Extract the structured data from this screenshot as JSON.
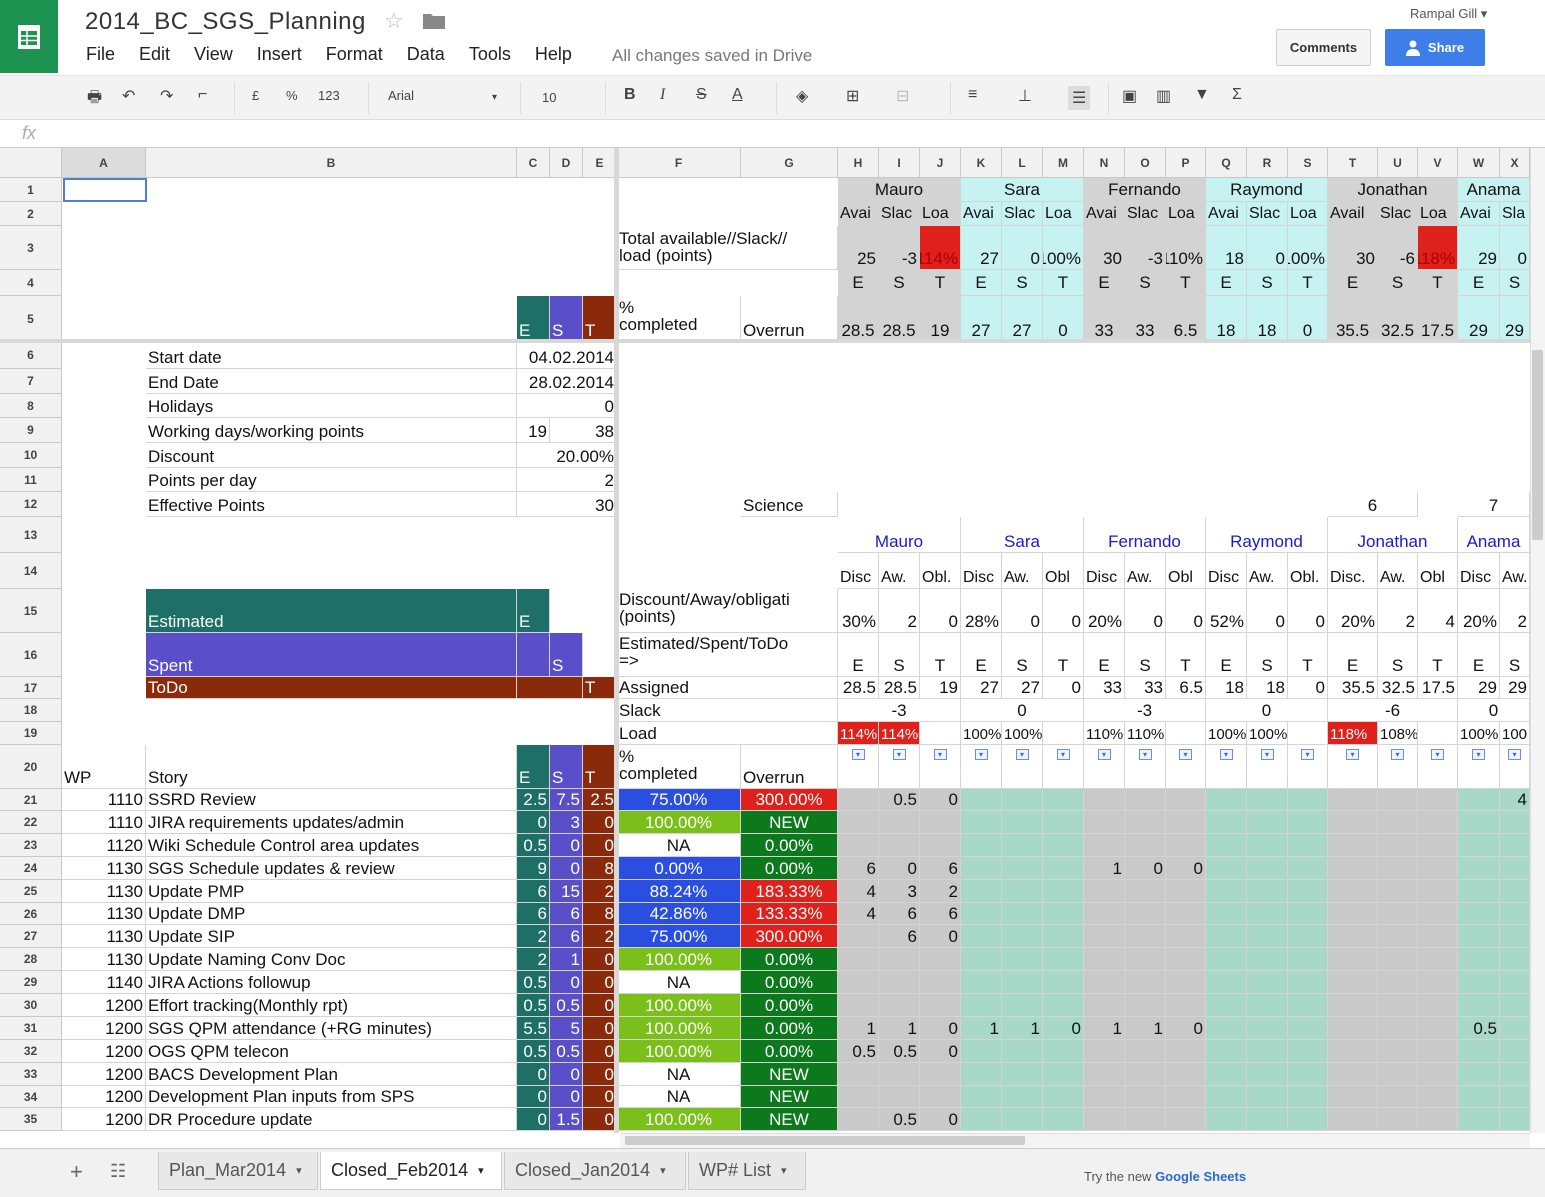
{
  "doc": {
    "title": "2014_BC_SGS_Planning",
    "save_status": "All changes saved in Drive",
    "user": "Rampal Gill",
    "comments": "Comments",
    "share": "Share"
  },
  "menu": [
    "File",
    "Edit",
    "View",
    "Insert",
    "Format",
    "Data",
    "Tools",
    "Help"
  ],
  "toolbar": {
    "font": "Arial",
    "size": "10",
    "currency": "£",
    "percent": "%",
    "format": "123"
  },
  "formula": {
    "fx": "fx"
  },
  "columns": [
    "A",
    "B",
    "C",
    "D",
    "E",
    "F",
    "G",
    "H",
    "I",
    "J",
    "K",
    "L",
    "M",
    "N",
    "O",
    "P",
    "Q",
    "R",
    "S",
    "T",
    "U",
    "V",
    "W",
    "X"
  ],
  "rows": [
    "1",
    "2",
    "3",
    "4",
    "5",
    "6",
    "7",
    "8",
    "9",
    "10",
    "11",
    "12",
    "13",
    "14",
    "15",
    "16",
    "17",
    "18",
    "19",
    "20",
    "21",
    "22",
    "23",
    "24",
    "25",
    "26",
    "27",
    "28",
    "29",
    "30",
    "31",
    "32",
    "33",
    "34",
    "35"
  ],
  "people": [
    "Mauro",
    "Sara",
    "Fernando",
    "Raymond",
    "Jonathan",
    "Anama"
  ],
  "subhdr2": [
    [
      "Avai",
      "Slac",
      "Loa"
    ],
    [
      "Avai",
      "Slac",
      "Loa"
    ],
    [
      "Avai",
      "Slac",
      "Loa"
    ],
    [
      "Avai",
      "Slac",
      "Loa"
    ],
    [
      "Avail",
      "Slac",
      "Loa"
    ],
    [
      "Avai",
      "Sla"
    ]
  ],
  "row3": {
    "label1": "Total available//Slack//",
    "label2": "load (points)",
    "vals": [
      "25",
      "-3",
      "114%",
      "27",
      "0",
      "100%",
      "30",
      "-3",
      "110%",
      "18",
      "0",
      "100%",
      "30",
      "-6",
      "118%",
      "29",
      "0"
    ]
  },
  "est_lbl": [
    "E",
    "S",
    "T"
  ],
  "row5": {
    "pct1": "%",
    "pct2": "completed",
    "overrun": "Overrun",
    "vals": [
      "28.5",
      "28.5",
      "19",
      "27",
      "27",
      "0",
      "33",
      "33",
      "6.5",
      "18",
      "18",
      "0",
      "35.5",
      "32.5",
      "17.5",
      "29",
      "29"
    ]
  },
  "settings": [
    [
      "Start date",
      "04.02.2014"
    ],
    [
      "End Date",
      "28.02.2014"
    ],
    [
      "Holidays",
      "0"
    ],
    [
      "Working days/working points",
      "19",
      "38"
    ],
    [
      "Discount",
      "20.00%"
    ],
    [
      "Points per day",
      "2"
    ],
    [
      "Effective Points",
      "30"
    ]
  ],
  "row12": {
    "science": "Science",
    "jon": "6",
    "anama": "7"
  },
  "row14": [
    [
      "Disc",
      "Aw.",
      "Obl."
    ],
    [
      "Disc",
      "Aw.",
      "Obl"
    ],
    [
      "Disc",
      "Aw.",
      "Obl"
    ],
    [
      "Disc",
      "Aw.",
      "Obl."
    ],
    [
      "Disc.",
      "Aw.",
      "Obl"
    ],
    [
      "Disc",
      "Aw."
    ]
  ],
  "row15": {
    "label1": "Discount/Away/obligati",
    "label2": "(points)",
    "vals": [
      "30%",
      "2",
      "0",
      "28%",
      "0",
      "0",
      "20%",
      "0",
      "0",
      "52%",
      "0",
      "0",
      "20%",
      "2",
      "4",
      "20%",
      "2"
    ]
  },
  "legend": {
    "estimated": "Estimated",
    "spent": "Spent",
    "todo": "ToDo",
    "e": "E",
    "s": "S",
    "t": "T"
  },
  "row16": {
    "label1": "Estimated/Spent/ToDo",
    "label2": "=>"
  },
  "row17": {
    "label": "Assigned",
    "vals": [
      "28.5",
      "28.5",
      "19",
      "27",
      "27",
      "0",
      "33",
      "33",
      "6.5",
      "18",
      "18",
      "0",
      "35.5",
      "32.5",
      "17.5",
      "29",
      "29"
    ]
  },
  "row18": {
    "label": "Slack",
    "vals": [
      "-3",
      "0",
      "-3",
      "0",
      "-6",
      "0"
    ]
  },
  "row19": {
    "label": "Load",
    "vals": [
      "114%",
      "114%",
      "100%",
      "100%",
      "110%",
      "110%",
      "100%",
      "100%",
      "118%",
      "108%",
      "100%",
      "100"
    ]
  },
  "row20": {
    "wp": "WP",
    "story": "Story",
    "e": "E",
    "s": "S",
    "t": "T",
    "pct1": "%",
    "pct2": "completed",
    "overrun": "Overrun"
  },
  "tasks": [
    {
      "row": "21",
      "wp": "1110",
      "story": "SSRD Review",
      "e": "2.5",
      "s": "7.5",
      "t": "2.5",
      "pct": "75.00%",
      "pctc": "blue",
      "ov": "300.00%",
      "ovc": "red",
      "h": [
        "",
        "0.5",
        "0"
      ],
      "x": "4"
    },
    {
      "row": "22",
      "wp": "1110",
      "story": "JIRA requirements updates/admin",
      "e": "0",
      "s": "3",
      "t": "0",
      "pct": "100.00%",
      "pctc": "green",
      "ov": "NEW",
      "ovc": "dgreen",
      "h": [
        "",
        "",
        ""
      ]
    },
    {
      "row": "23",
      "wp": "1120",
      "story": "Wiki Schedule Control area updates",
      "e": "0.5",
      "s": "0",
      "t": "0",
      "pct": "NA",
      "pctc": "white",
      "ov": "0.00%",
      "ovc": "dgreen",
      "h": [
        "",
        "",
        ""
      ]
    },
    {
      "row": "24",
      "wp": "1130",
      "story": "SGS Schedule updates & review",
      "e": "9",
      "s": "0",
      "t": "8",
      "pct": "0.00%",
      "pctc": "blue",
      "ov": "0.00%",
      "ovc": "dgreen",
      "h": [
        "6",
        "0",
        "6"
      ],
      "n": [
        "1",
        "0",
        "0"
      ]
    },
    {
      "row": "25",
      "wp": "1130",
      "story": "Update PMP",
      "e": "6",
      "s": "15",
      "t": "2",
      "pct": "88.24%",
      "pctc": "blue",
      "ov": "183.33%",
      "ovc": "red",
      "h": [
        "4",
        "3",
        "2"
      ]
    },
    {
      "row": "26",
      "wp": "1130",
      "story": "Update DMP",
      "e": "6",
      "s": "6",
      "t": "8",
      "pct": "42.86%",
      "pctc": "blue",
      "ov": "133.33%",
      "ovc": "red",
      "h": [
        "4",
        "6",
        "6"
      ]
    },
    {
      "row": "27",
      "wp": "1130",
      "story": "Update SIP",
      "e": "2",
      "s": "6",
      "t": "2",
      "pct": "75.00%",
      "pctc": "blue",
      "ov": "300.00%",
      "ovc": "red",
      "h": [
        "",
        "6",
        "0"
      ]
    },
    {
      "row": "28",
      "wp": "1130",
      "story": "Update Naming Conv Doc",
      "e": "2",
      "s": "1",
      "t": "0",
      "pct": "100.00%",
      "pctc": "green",
      "ov": "0.00%",
      "ovc": "dgreen",
      "h": [
        "",
        "",
        ""
      ]
    },
    {
      "row": "29",
      "wp": "1140",
      "story": "JIRA Actions followup",
      "e": "0.5",
      "s": "0",
      "t": "0",
      "pct": "NA",
      "pctc": "white",
      "ov": "0.00%",
      "ovc": "dgreen",
      "h": [
        "",
        "",
        ""
      ]
    },
    {
      "row": "30",
      "wp": "1200",
      "story": "Effort tracking(Monthly rpt)",
      "e": "0.5",
      "s": "0.5",
      "t": "0",
      "pct": "100.00%",
      "pctc": "green",
      "ov": "0.00%",
      "ovc": "dgreen",
      "h": [
        "",
        "",
        ""
      ]
    },
    {
      "row": "31",
      "wp": "1200",
      "story": "SGS QPM attendance (+RG minutes)",
      "e": "5.5",
      "s": "5",
      "t": "0",
      "pct": "100.00%",
      "pctc": "green",
      "ov": "0.00%",
      "ovc": "dgreen",
      "h": [
        "1",
        "1",
        "0"
      ],
      "k": [
        "1",
        "1",
        "0"
      ],
      "n": [
        "1",
        "1",
        "0"
      ],
      "w": "0.5"
    },
    {
      "row": "32",
      "wp": "1200",
      "story": "OGS QPM telecon",
      "e": "0.5",
      "s": "0.5",
      "t": "0",
      "pct": "100.00%",
      "pctc": "green",
      "ov": "0.00%",
      "ovc": "dgreen",
      "h": [
        "0.5",
        "0.5",
        "0"
      ]
    },
    {
      "row": "33",
      "wp": "1200",
      "story": "BACS Development Plan",
      "e": "0",
      "s": "0",
      "t": "0",
      "pct": "NA",
      "pctc": "white",
      "ov": "NEW",
      "ovc": "dgreen",
      "h": [
        "",
        "",
        ""
      ]
    },
    {
      "row": "34",
      "wp": "1200",
      "story": "Development Plan inputs from SPS",
      "e": "0",
      "s": "0",
      "t": "0",
      "pct": "NA",
      "pctc": "white",
      "ov": "NEW",
      "ovc": "dgreen",
      "h": [
        "",
        "",
        ""
      ]
    },
    {
      "row": "35",
      "wp": "1200",
      "story": "DR Procedure update",
      "e": "0",
      "s": "1.5",
      "t": "0",
      "pct": "100.00%",
      "pctc": "green",
      "ov": "NEW",
      "ovc": "dgreen",
      "h": [
        "",
        "0.5",
        "0"
      ]
    }
  ],
  "sheets": [
    "Plan_Mar2014",
    "Closed_Feb2014",
    "Closed_Jan2014",
    "WP# List"
  ],
  "active_sheet": "Closed_Feb2014",
  "try_text": "Try the new",
  "try_brand": "Google Sheets",
  "colors": {
    "teal": "#1e6f68",
    "purple": "#5a4fc9",
    "brown": "#8b2a0a",
    "grey": "#d3d3d3",
    "cyan": "#c7f2f2",
    "red": "#e0201a",
    "blue": "#2a4fe0",
    "green": "#7abf1a",
    "dgreen": "#0c7a1c",
    "mint": "#a8d8c8"
  }
}
